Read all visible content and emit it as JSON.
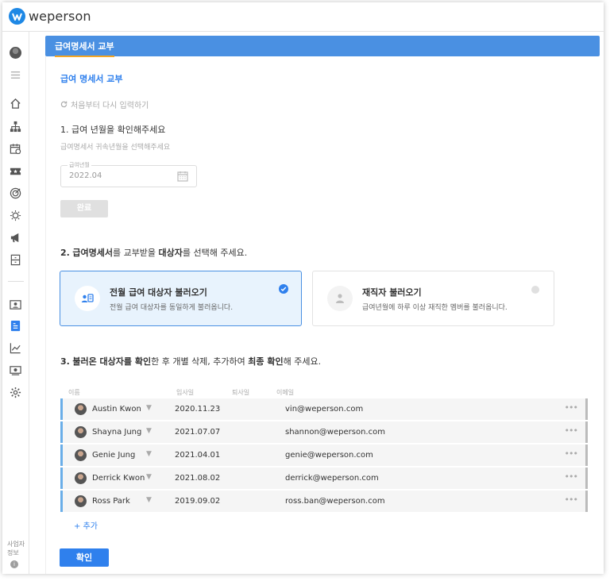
{
  "app": {
    "logo_text": "weperson",
    "brand_color": "#1e88e5"
  },
  "sidebar": {
    "icons": [
      "avatar",
      "menu-icon",
      "home-icon",
      "org-chart-icon",
      "calendar-icon",
      "ticket-icon",
      "target-icon",
      "idea-icon",
      "megaphone-icon",
      "cabinet-icon",
      "id-card-icon",
      "payslip-icon",
      "chart-icon",
      "money-icon",
      "settings-icon"
    ],
    "footer_label": "사업자정보"
  },
  "tab": {
    "label": "급여명세서 교부"
  },
  "page": {
    "title": "급여 명세서 교부",
    "reset_label": "처음부터 다시 입력하기"
  },
  "step1": {
    "number": "1.",
    "title": "급여 년월을 확인해주세요",
    "subtitle": "급여명세서 귀속년월을 선택해주세요",
    "field_label": "급여년월",
    "field_value": "2022.04",
    "done_label": "완료"
  },
  "step2": {
    "number": "2.",
    "title_parts": [
      "급여명세서",
      "를 교부받을 ",
      "대상자",
      "를 선택해 주세요."
    ],
    "cards": [
      {
        "title": "전월 급여 대상자 불러오기",
        "desc": "전월 급여 대상자를 동일하게 불러옵니다.",
        "selected": true
      },
      {
        "title": "재직자 불러오기",
        "desc": "급여년월에 하루 이상 재직한 멤버를 불러옵니다.",
        "selected": false
      }
    ]
  },
  "step3": {
    "number": "3.",
    "title_parts": [
      "불러온 대상자를 확인",
      "한 후 개별 삭제, 추가하여 ",
      "최종 확인",
      "해 주세요."
    ],
    "columns": [
      "이름",
      "입사일",
      "퇴사일",
      "이메일"
    ],
    "rows": [
      {
        "name": "Austin Kwon",
        "join": "2020.11.23",
        "leave": "",
        "email": "vin@weperson.com"
      },
      {
        "name": "Shayna Jung",
        "join": "2021.07.07",
        "leave": "",
        "email": "shannon@weperson.com"
      },
      {
        "name": "Genie Jung",
        "join": "2021.04.01",
        "leave": "",
        "email": "genie@weperson.com"
      },
      {
        "name": "Derrick Kwon",
        "join": "2021.08.02",
        "leave": "",
        "email": "derrick@weperson.com"
      },
      {
        "name": "Ross Park",
        "join": "2019.09.02",
        "leave": "",
        "email": "ross.ban@weperson.com"
      }
    ],
    "add_label": "+ 추가",
    "more_label": "•••"
  },
  "confirm_label": "확인",
  "colors": {
    "accent": "#2f80ed",
    "tab_bg": "#4a90e2",
    "tab_underline": "#f5a623",
    "row_bar": "#6aaee8"
  }
}
